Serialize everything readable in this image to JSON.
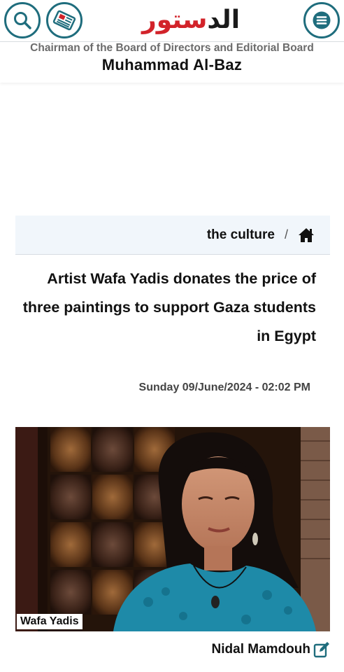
{
  "header": {
    "logo_text_dark": "الد",
    "logo_text_red": "ستور",
    "search_icon": "search-icon",
    "newspaper_icon": "newspaper-icon",
    "menu_icon": "menu-icon",
    "accent_color": "#1f6d7d",
    "brand_red": "#d2232a"
  },
  "masthead": {
    "subtitle": "Chairman of the Board of Directors and Editorial Board",
    "name": "Muhammad Al-Baz"
  },
  "breadcrumb": {
    "section": "the culture",
    "separator": "/",
    "home_icon": "home-icon"
  },
  "article": {
    "title": "Artist Wafa Yadis donates the price of three paintings to support Gaza students in Egypt",
    "date": "Sunday 09/June/2024 - 02:02 PM",
    "image_caption": "Wafa Yadis",
    "author": "Nidal Mamdouh",
    "author_icon": "edit-icon"
  }
}
